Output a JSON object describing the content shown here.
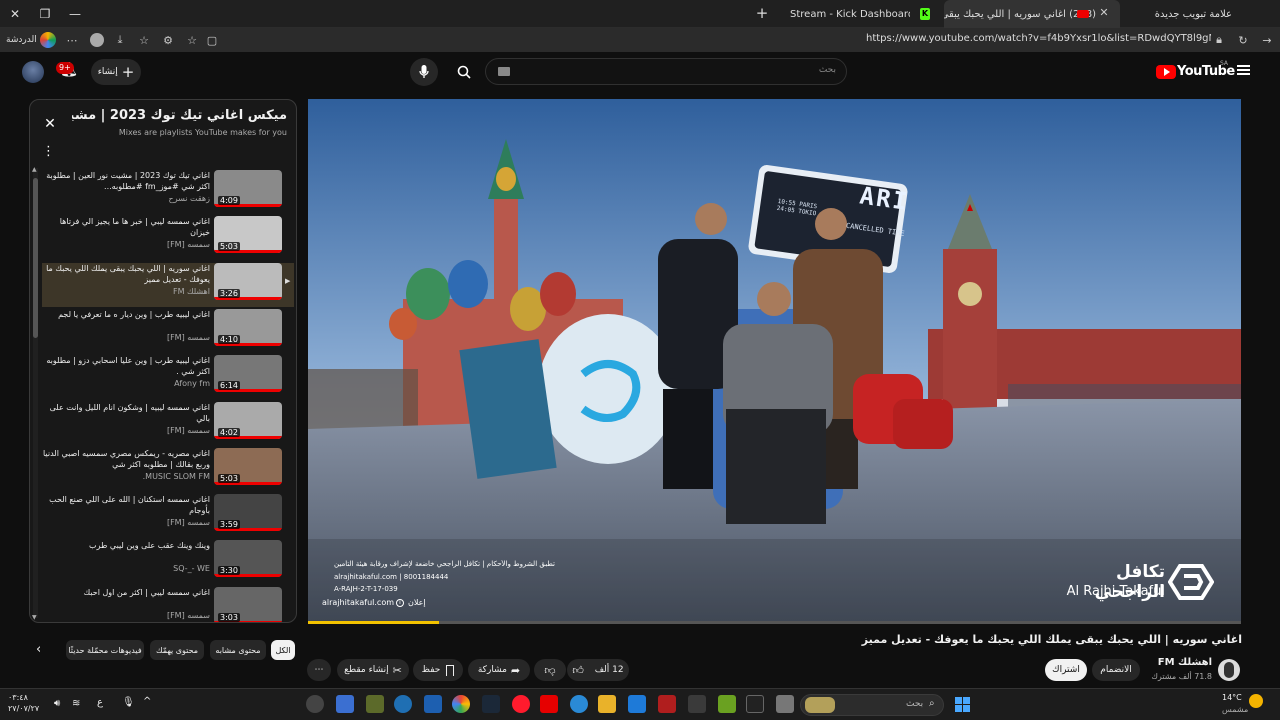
{
  "browser": {
    "tabs": [
      {
        "label": "علامة تبويب جديدة"
      },
      {
        "label": "(248) اغاني سوريه | اللي يحبك يبقى",
        "badge": "(248)",
        "active": true
      },
      {
        "label": "Stream - Kick Dashboard"
      }
    ],
    "url": "https://www.youtube.com/watch?v=f4b9Yxsr1lo&list=RDwdQYT8l9gME&index=4",
    "chat_label": "الدردشة"
  },
  "youtube": {
    "logo_text": "YouTube",
    "region": "SA",
    "search_placeholder": "بحث",
    "create_label": "إنشاء",
    "notifications_badge": "9+"
  },
  "playlist": {
    "title": "ميكس اغاني تيك توك 2023 | مشيت...",
    "subtitle": "Mixes are playlists YouTube makes for you",
    "items": [
      {
        "title": "اغاني تيك توك 2023 | مشيت نور العين | مطلوبة اكثر شي #موز_fm #مطلوبه...",
        "channel": "زهقت نسرح",
        "duration": "4:09"
      },
      {
        "title": "اغاني سمسه ليبي | خبر ها ما يجيز الي فرتاها خيزان",
        "channel": "سمسه [FM]",
        "duration": "5:03"
      },
      {
        "title": "اغاني سوريه | اللي يحبك يبقى يملك اللي يحبك ما يعوفك - تعديل مميز",
        "channel": "اهشلك FM",
        "duration": "3:26",
        "active": true
      },
      {
        "title": "اغاني ليبيه طرب | وين ديار ه ما تعرفي يا لجم",
        "channel": "سمسه [FM]",
        "duration": "4:10"
      },
      {
        "title": "اغاني ليبيه طرب | وين عليا اسحابي دزو | مطلوبه اكثر شي .",
        "channel": "Afony fm",
        "duration": "6:14"
      },
      {
        "title": "اغاني سمسه ليبيه | وشكون انام الليل وانت على بالي",
        "channel": "سمسه [FM]",
        "duration": "4:02"
      },
      {
        "title": "اغاني مصريه - ريمكس مصري سمسيه اصبي الدنيا وربع بقالك | مطلوبه اكثر شي",
        "channel": "MUSIC SLOM FM.",
        "duration": "5:03"
      },
      {
        "title": "اغاني سمسه استكنان | الله على اللي صنع الحب بأوجام",
        "channel": "سمسه [FM]",
        "duration": "3:59"
      },
      {
        "title": "وينك وينك عقب على وين ليبي طرب",
        "channel": "SQ-_- WE",
        "duration": "3:30"
      },
      {
        "title": "اغاني سمسه ليبي | اكثر من اول احبك",
        "channel": "سمسه [FM]",
        "duration": "3:03"
      }
    ]
  },
  "ad": {
    "brand_ar": "تكافل الراجحي",
    "brand_en": "Al Rajhi Takaful",
    "disclaimer": "تطبق الشروط والأحكام | تكافل الراجحي خاضعة لإشراف ورقابة هيئة التأمين",
    "contact": "alrajhitakaful.com | 8001184444",
    "code": "A-RAJH-2-T-17-039",
    "site": "alrajhitakaful.com",
    "ad_label": "إعلان",
    "board_text": "ARI",
    "board_line1": "10:55 PARIS",
    "board_line2": "24:05 TOKIO",
    "board_status": "CANCELLED TIME",
    "progress_fraction": 0.14
  },
  "video": {
    "title": "اغاني سوريه | اللي يحبك يبقى يملك اللي يحبك ما يعوفك - تعديل مميز",
    "channel": "اهشلك FM",
    "subscribers": "71.8 ألف مشترك",
    "join_label": "الانضمام",
    "subscribe_label": "اشتراك",
    "likes": "12 ألف",
    "share_label": "مشاركة",
    "save_label": "حفظ",
    "clip_label": "إنشاء مقطع"
  },
  "chips": [
    "الكل",
    "محتوى مشابه",
    "محتوى يهمّك",
    "فيديوهات محمّلة حديثًا"
  ],
  "taskbar": {
    "weather_temp": "14°C",
    "weather_desc": "مشمس",
    "search_label": "بحث",
    "time": "٠٣:٤٨",
    "date": "٢٧/٠٧/٢٧",
    "lang": "ع"
  }
}
